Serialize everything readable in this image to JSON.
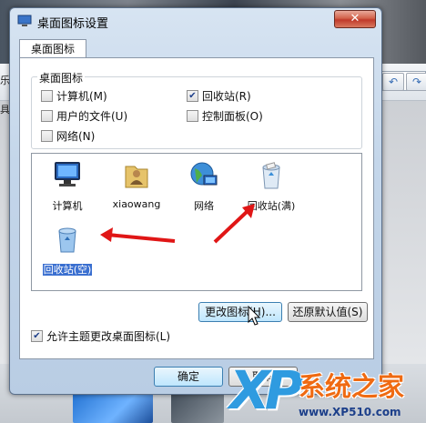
{
  "dialog": {
    "title": "桌面图标设置",
    "close_label": "✕",
    "tab_label": "桌面图标",
    "group_label": "桌面图标",
    "checkboxes": [
      {
        "label": "计算机(M)",
        "checked": false
      },
      {
        "label": "回收站(R)",
        "checked": true
      },
      {
        "label": "用户的文件(U)",
        "checked": false
      },
      {
        "label": "控制面板(O)",
        "checked": false
      },
      {
        "label": "网络(N)",
        "checked": false
      }
    ],
    "icons": [
      {
        "label": "计算机"
      },
      {
        "label": "xiaowang"
      },
      {
        "label": "网络"
      },
      {
        "label": "回收站(满)"
      },
      {
        "label": "回收站(空)"
      }
    ],
    "change_icon_button": "更改图标(H)...",
    "restore_default_button": "还原默认值(S)",
    "allow_theme_label": "允许主题更改桌面图标(L)",
    "allow_theme_checked": true,
    "ok_button": "确定",
    "cancel_button": "取消"
  },
  "background": {
    "edge_text_1": "乐",
    "edge_text_2": "具"
  },
  "logo": {
    "brand_text": "系统之家",
    "url_text": "www.XP510.com",
    "brand_color": "#ef6a12",
    "xp_color": "#2f9be0"
  },
  "arrow_color": "#e01616"
}
